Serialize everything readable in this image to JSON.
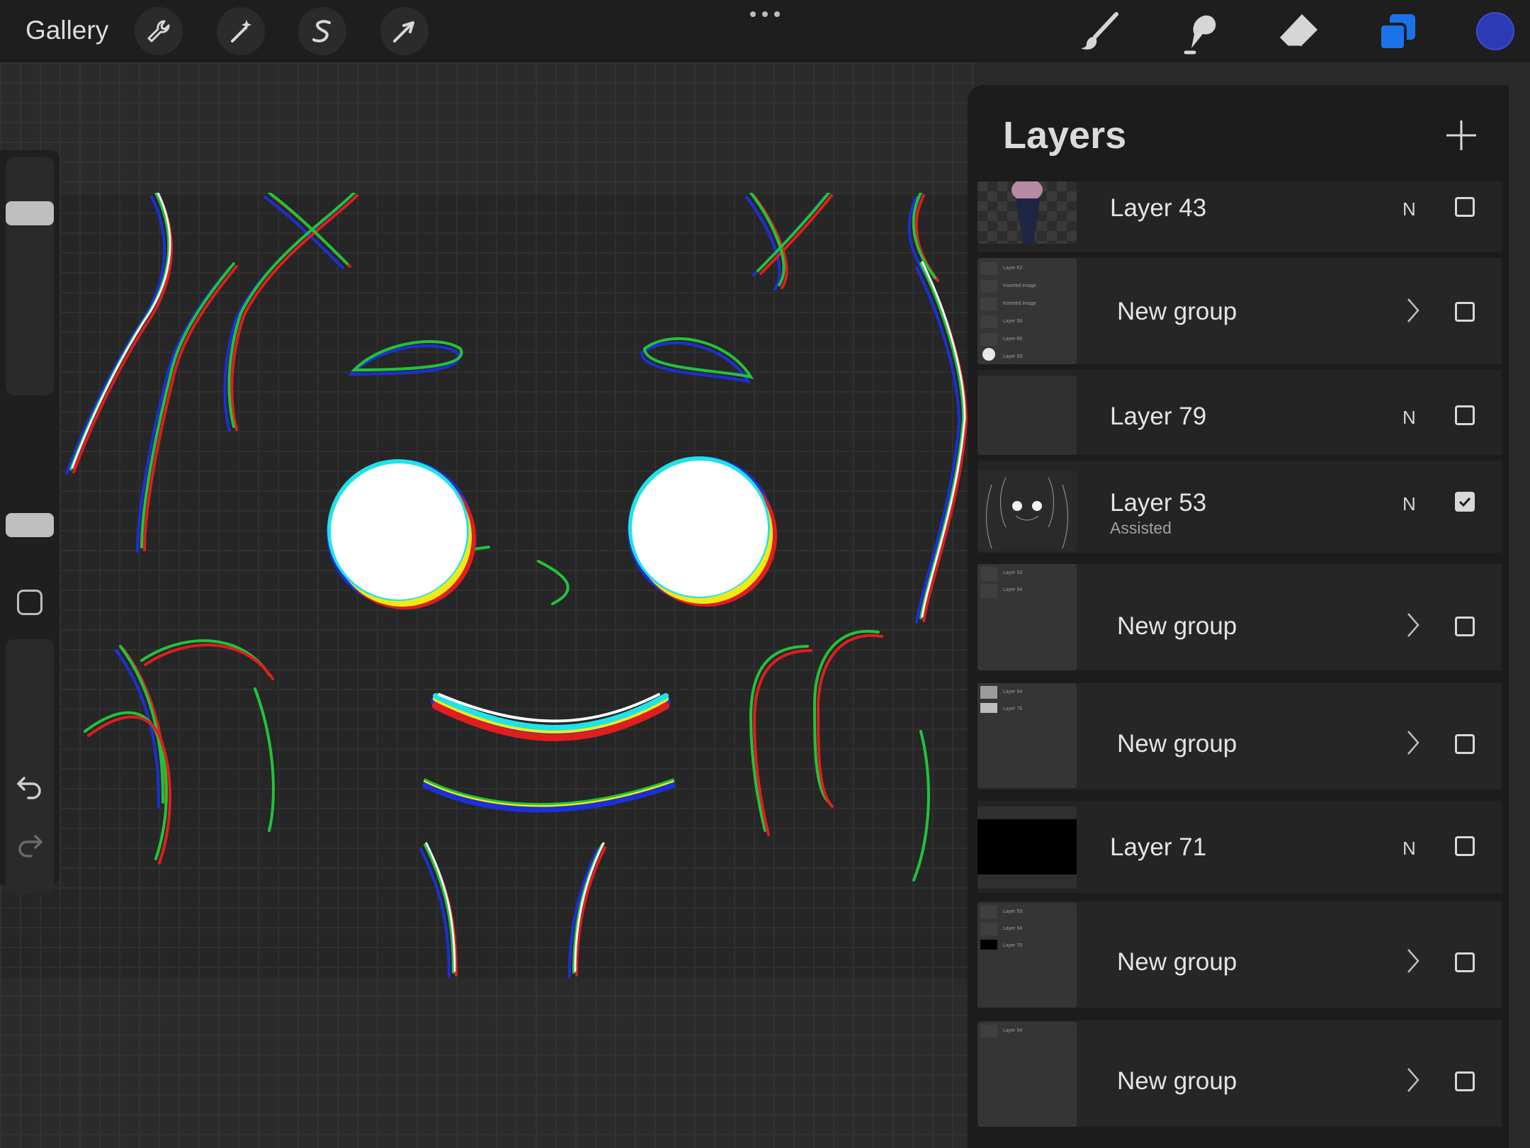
{
  "topbar": {
    "gallery_label": "Gallery",
    "tools_left": [
      "wrench-icon",
      "magic-wand-icon",
      "selection-s-icon",
      "transform-arrow-icon"
    ],
    "tools_right": [
      "brush-icon",
      "smudge-icon",
      "eraser-icon",
      "layers-icon"
    ],
    "color_swatch": "#2c3bb5",
    "accent": "#1a73e8"
  },
  "layers_panel": {
    "title": "Layers",
    "rows": [
      {
        "kind": "layer",
        "name": "Layer 43",
        "blend": "N",
        "visible": false
      },
      {
        "kind": "group",
        "name": "New group",
        "visible": false,
        "thumb_lines": [
          "Layer 62",
          "Inserted Image",
          "Inserted Image",
          "Layer 56",
          "Layer 60",
          "Layer 59"
        ]
      },
      {
        "kind": "layer",
        "name": "Layer 79",
        "blend": "N",
        "visible": false
      },
      {
        "kind": "layer",
        "name": "Layer 53",
        "sub": "Assisted",
        "blend": "N",
        "visible": true
      },
      {
        "kind": "group",
        "name": "New group",
        "visible": false,
        "thumb_lines": [
          "Layer 53",
          "Layer 54"
        ]
      },
      {
        "kind": "group",
        "name": "New group",
        "visible": false,
        "thumb_lines": [
          "Layer 54",
          "Layer 76"
        ]
      },
      {
        "kind": "layer",
        "name": "Layer 71",
        "blend": "N",
        "visible": false
      },
      {
        "kind": "group",
        "name": "New group",
        "visible": false,
        "thumb_lines": [
          "Layer 53",
          "Layer 54",
          "Layer 70"
        ]
      },
      {
        "kind": "group",
        "name": "New group",
        "visible": false,
        "thumb_lines": [
          "Layer 54"
        ]
      }
    ]
  }
}
